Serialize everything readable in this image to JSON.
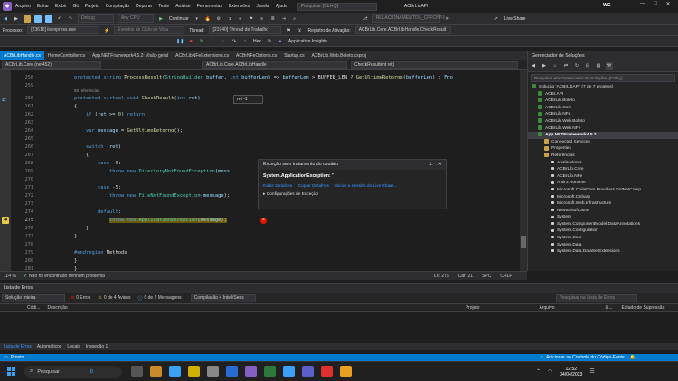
{
  "menubar": {
    "items": [
      "Arquivo",
      "Editar",
      "Exibir",
      "Git",
      "Projeto",
      "Compilação",
      "Depurar",
      "Teste",
      "Análise",
      "Ferramentas",
      "Extensões",
      "Janela",
      "Ajuda"
    ],
    "search_placeholder": "Pesquisar (Ctrl+Q)",
    "solution_title": "ACBrLibAPI",
    "user_initials": "WG",
    "live_share": "Live Share"
  },
  "toolbar1": {
    "config": "Debug",
    "platform": "Any CPU",
    "continue": "Continuar",
    "branch": "RELACIONAMENTOS_CFFCNPJ"
  },
  "toolbar2": {
    "process_label": "Processo:",
    "process_value": "[23616] iisexpress.exe",
    "lifecycle": "Eventos de Ciclo de Vida",
    "thread_label": "Thread:",
    "thread_value": "[21940] Thread de Trabalho",
    "stack_label": "Registro de Ativação:",
    "stack_value": "ACBrLib.Core.ACBrLibHandle.CheckResult",
    "hex": "Hex",
    "insights": "Application Insights"
  },
  "tabs": [
    "ACBrLibHandle.cs",
    "HomeController.cs",
    "App.NETFramework4.5.2: Visão geral",
    "ACBrLibNFeExtensions.cs",
    "ACBrNFeOptions.cs",
    "Startup.cs",
    "ACBrLib.Web.Boleto.csproj"
  ],
  "navbar": {
    "project": "ACBrLib.Core (net452)",
    "class": "ACBrLib.Core.ACBrLibHandle",
    "member": "CheckResult(int ret)"
  },
  "editor": {
    "lines": [
      {
        "n": "258",
        "refs": false
      },
      {
        "n": "259",
        "refs": false
      },
      {
        "n": "260",
        "refs": true
      },
      {
        "n": "261",
        "refs": false
      },
      {
        "n": "262",
        "refs": false
      },
      {
        "n": "263",
        "refs": false
      },
      {
        "n": "264",
        "refs": false
      },
      {
        "n": "265",
        "refs": false
      },
      {
        "n": "266",
        "refs": false
      },
      {
        "n": "267",
        "refs": false
      },
      {
        "n": "268",
        "refs": false
      },
      {
        "n": "269",
        "refs": false
      },
      {
        "n": "270",
        "refs": false
      },
      {
        "n": "271",
        "refs": false
      },
      {
        "n": "272",
        "refs": false
      },
      {
        "n": "273",
        "refs": false
      },
      {
        "n": "274",
        "refs": false
      },
      {
        "n": "275",
        "refs": false
      },
      {
        "n": "276",
        "refs": false
      },
      {
        "n": "277",
        "refs": false
      },
      {
        "n": "278",
        "refs": false
      },
      {
        "n": "279",
        "refs": false
      },
      {
        "n": "280",
        "refs": false
      },
      {
        "n": "281",
        "refs": false
      }
    ],
    "refs_text": "88 referências",
    "tooltip": "ret -1",
    "zoom": "114 %",
    "issues": "Não foi encontrado nenhum problema",
    "ln": "Ln: 275",
    "col": "Car: 21",
    "spc": "SPC",
    "crlf": "CRLF"
  },
  "exception": {
    "title": "Exceção sem tratamento do usuário",
    "type": "System.ApplicationException: ''",
    "links": [
      "Exibir Detalhes",
      "Copiar Detalhes",
      "Iniciar a Sessão do Live Share..."
    ],
    "config": "Configurações de Exceção"
  },
  "errors": {
    "title": "Lista de Erros",
    "scope": "Solução Inteira",
    "errors": "0 Erros",
    "warnings": "0 de 4 Avisos",
    "messages": "0 de 2 Mensagens",
    "build": "Compilação + IntelliSens",
    "search": "Pesquisar na Lista de Erros",
    "columns": [
      "Códi...",
      "Descrição",
      "Projeto",
      "Arquivo",
      "Li...",
      "Estado de Supressão"
    ]
  },
  "bottom_tabs": [
    "Lista de Erros",
    "Automáticos",
    "Locais",
    "Inspeção 1"
  ],
  "statusbar": {
    "ready": "Pronto",
    "source_control": "Adicionar ao Controle do Código-Fonte"
  },
  "solution": {
    "title": "Gerenciador de Soluções",
    "search": "Pesquisar em Gerenciador de Soluções (Ctrl+ç)",
    "nodes": [
      {
        "label": "Solução 'ACBrLibAPI' (7 de 7 projetos)",
        "kind": "sol",
        "indent": 0
      },
      {
        "label": "ACBr.API",
        "kind": "proj",
        "indent": 1
      },
      {
        "label": "ACBrLib.Boleto",
        "kind": "proj",
        "indent": 1
      },
      {
        "label": "ACBrLib.Core",
        "kind": "proj",
        "indent": 1
      },
      {
        "label": "ACBrLib.NFe",
        "kind": "proj",
        "indent": 1
      },
      {
        "label": "ACBrLib.Web.Boleto",
        "kind": "proj",
        "indent": 1
      },
      {
        "label": "ACBrLib.Web.NFe",
        "kind": "proj",
        "indent": 1
      },
      {
        "label": "App.NETFramework4.5.2",
        "kind": "proj",
        "indent": 1,
        "selected": true
      },
      {
        "label": "Connected Services",
        "kind": "fold",
        "indent": 2
      },
      {
        "label": "Properties",
        "kind": "fold",
        "indent": 2
      },
      {
        "label": "Referências",
        "kind": "fold",
        "indent": 2
      },
      {
        "label": "Analisadores",
        "kind": "ref",
        "indent": 3
      },
      {
        "label": "ACBrLib.Core",
        "kind": "ref",
        "indent": 3
      },
      {
        "label": "ACBrLib.NFe",
        "kind": "ref",
        "indent": 3
      },
      {
        "label": "Antlr3.Runtime",
        "kind": "ref",
        "indent": 3
      },
      {
        "label": "Microsoft.CodeDom.Providers.DotNetComp",
        "kind": "ref",
        "indent": 3
      },
      {
        "label": "Microsoft.CSharp",
        "kind": "ref",
        "indent": 3
      },
      {
        "label": "Microsoft.Web.Infrastructure",
        "kind": "ref",
        "indent": 3
      },
      {
        "label": "Newtonsoft.Json",
        "kind": "ref",
        "indent": 3
      },
      {
        "label": "System",
        "kind": "ref",
        "indent": 3
      },
      {
        "label": "System.ComponentModel.DataAnnotations",
        "kind": "ref",
        "indent": 3
      },
      {
        "label": "System.Configuration",
        "kind": "ref",
        "indent": 3
      },
      {
        "label": "System.Core",
        "kind": "ref",
        "indent": 3
      },
      {
        "label": "System.Data",
        "kind": "ref",
        "indent": 3
      },
      {
        "label": "System.Data.DataSetExtensions",
        "kind": "ref",
        "indent": 3
      }
    ]
  },
  "taskbar": {
    "search": "Pesquisar",
    "time": "12:52",
    "date": "04/04/2023"
  },
  "colors": {
    "accent": "#007acc",
    "error": "#e51400",
    "highlight": "#6b5d10"
  }
}
